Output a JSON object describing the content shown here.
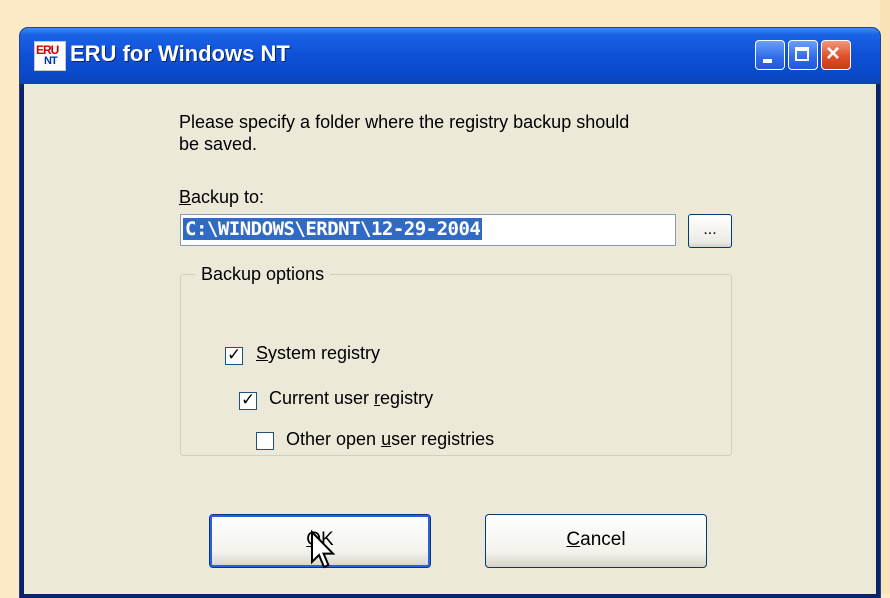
{
  "window": {
    "title": "ERU for Windows NT",
    "icon": "eru-app-icon",
    "icon_text_top": "ERU",
    "icon_text_bottom": "NT"
  },
  "dialog": {
    "prompt": "Please specify a folder where the registry backup should be saved.",
    "backup_label_accel": "B",
    "backup_label_rest": "ackup to:",
    "backup_path": "C:\\WINDOWS\\ERDNT\\12-29-2004",
    "browse_label": "...",
    "group_title": "Backup options",
    "options": [
      {
        "pre": "",
        "accel": "S",
        "post": "ystem registry",
        "checked": true
      },
      {
        "pre": "Current user ",
        "accel": "r",
        "post": "egistry",
        "checked": true
      },
      {
        "pre": "Other open ",
        "accel": "u",
        "post": "ser registries",
        "checked": false
      }
    ],
    "ok": {
      "accel": "O",
      "rest": "K"
    },
    "cancel": {
      "accel": "C",
      "rest": "ancel"
    }
  },
  "colors": {
    "titlebar": "#0a49cb",
    "selection": "#316ac5",
    "close_button": "#e0502a",
    "dialog_bg": "#ece9d8"
  }
}
